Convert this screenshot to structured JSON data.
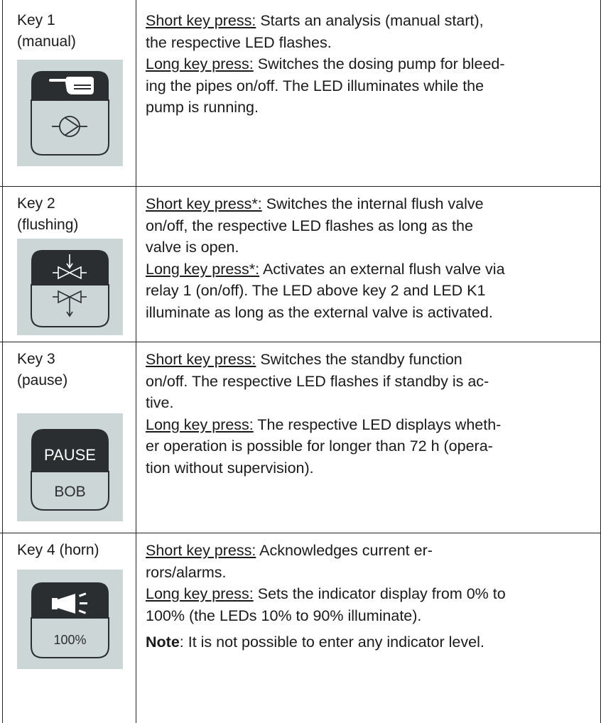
{
  "rows": [
    {
      "key": "Key 1",
      "sub": "(manual)",
      "icon": {
        "top": "hand-icon",
        "bottom": "pump-icon"
      },
      "short_label": "Short key press:",
      "short_text": " Starts an analysis (manual start),",
      "short_text2": "the respective LED flashes.",
      "long_label": "Long key press:",
      "long_text": " Switches the dosing pump for bleed-",
      "long_text2": "ing the pipes on/off. The LED illuminates while the",
      "long_text3": "pump is running."
    },
    {
      "key": "Key 2",
      "sub": "(flushing)",
      "icon": {
        "top": "flush-valve-in-icon",
        "bottom": "flush-valve-out-icon"
      },
      "short_label": "Short key press*:",
      "short_text": " Switches the internal flush valve",
      "short_text2": "on/off, the respective LED flashes as long as the",
      "short_text3": "valve is open.",
      "long_label": "Long key press*:",
      "long_text": " Activates an external flush valve via",
      "long_text2": "relay 1 (on/off). The LED above key 2 and LED K1",
      "long_text3": "illuminate as long as the external valve is activated."
    },
    {
      "key": "Key 3",
      "sub": "(pause)",
      "icon": {
        "top_text": "PAUSE",
        "bottom_text": "BOB"
      },
      "short_label": "Short key press:",
      "short_text": " Switches the standby function",
      "short_text2": "on/off. The respective LED flashes if standby is ac-",
      "short_text3": "tive.",
      "long_label": "Long key press:",
      "long_text": " The respective LED displays wheth-",
      "long_text2": "er operation is possible for longer than 72 h (opera-",
      "long_text3": "tion without supervision)."
    },
    {
      "key": "Key 4 (horn)",
      "icon": {
        "top": "horn-icon",
        "bottom_text": "100%"
      },
      "short_label": "Short key press:",
      "short_text": " Acknowledges current er-",
      "short_text2": "rors/alarms.",
      "long_label": "Long key press:",
      "long_text": " Sets the indicator display from 0% to",
      "long_text2": "100% (the LEDs 10% to 90% illuminate).",
      "note_label": "Note",
      "note_text": ": It is not possible to enter any indicator level."
    }
  ]
}
